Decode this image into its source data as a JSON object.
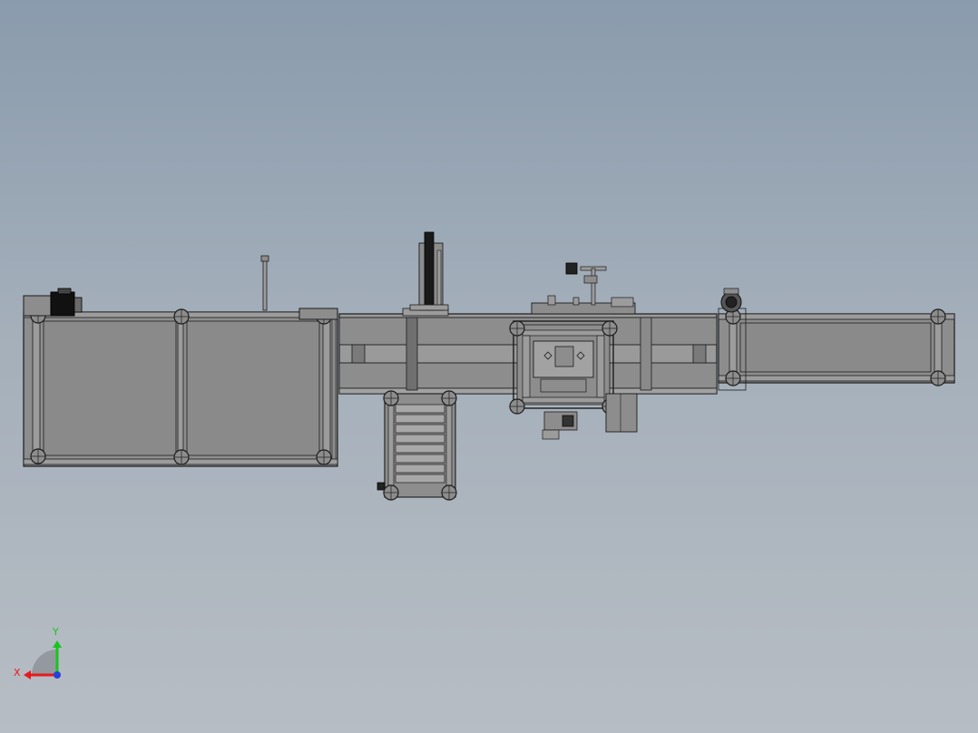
{
  "triad": {
    "x_label": "X",
    "y_label": "Y",
    "x_color": "#e8191c",
    "y_color": "#19c41c",
    "z_color": "#2640d8"
  },
  "colors": {
    "background_top": "#8a9bad",
    "background_bottom": "#b7bdc4",
    "part_fill": "#8d8d8d",
    "part_fill_light": "#9c9c9c",
    "part_fill_dark": "#7a7a7a",
    "edge": "#1c1c1c",
    "motor": "#111111"
  }
}
